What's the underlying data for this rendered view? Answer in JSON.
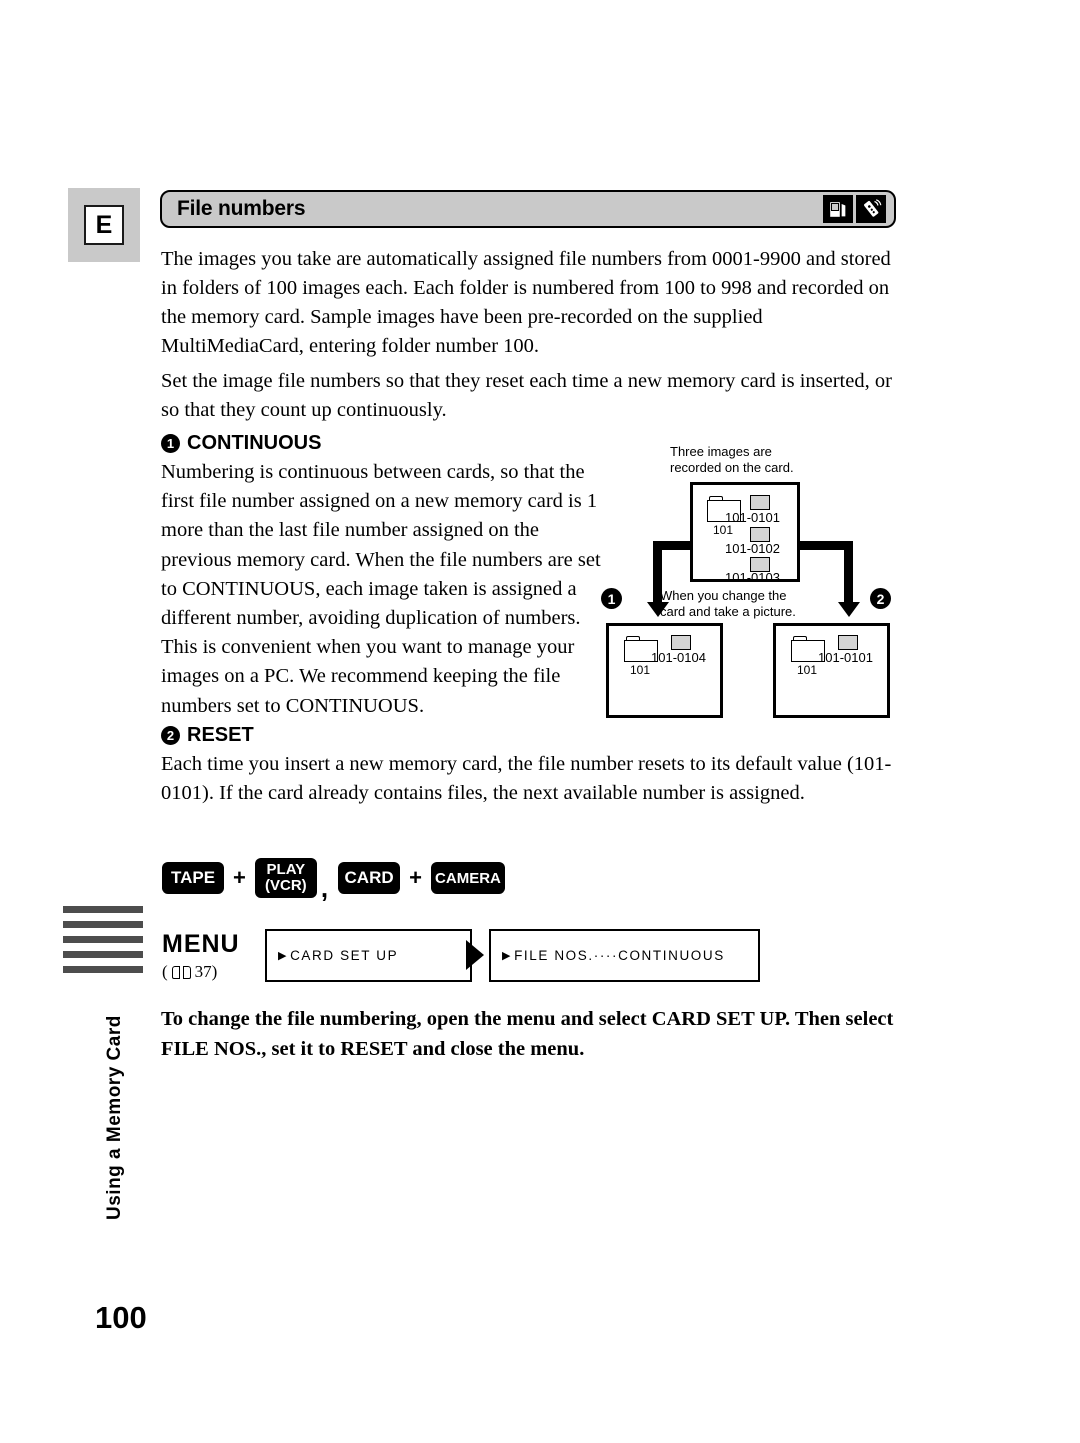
{
  "page": {
    "number": "100",
    "edition_marker": "E",
    "sidebar_vertical_text": "Using a Memory Card"
  },
  "header": {
    "title": "File numbers",
    "icons": [
      "memory-card-icon",
      "remote-control-icon"
    ]
  },
  "intro": {
    "paragraph_1": "The images you take are automatically assigned file numbers from 0001-9900 and stored in folders of 100 images each. Each folder is numbered from 100 to 998 and recorded on the memory card. Sample images have been pre-recorded on the supplied MultiMediaCard, entering folder number 100.",
    "paragraph_2": "Set the image file numbers so that they reset each time a new memory card is inserted, or so that they count up continuously."
  },
  "sections": [
    {
      "number": "1",
      "title": "CONTINUOUS",
      "body": "Numbering is continuous between cards, so that the first file number assigned on a new memory card is 1 more than the last file number assigned on the previous memory card. When the file numbers are set to CONTINUOUS, each image taken is assigned a different number, avoiding duplication of numbers. This is convenient when you want to manage your images on a PC. We recommend keeping the file numbers set to CONTINUOUS."
    },
    {
      "number": "2",
      "title": "RESET",
      "body": "Each time you insert a new memory card, the file number resets to its default value (101-0101). If the card already contains files, the next available number is assigned."
    }
  ],
  "diagram": {
    "caption_top": "Three images are\nrecorded on the card.",
    "caption_middle": "When you change the\ncard and take a picture.",
    "marker_left": "1",
    "marker_right": "2",
    "top_card": {
      "folder": "101",
      "files": [
        "101-0101",
        "101-0102",
        "101-0103"
      ]
    },
    "left_card": {
      "folder": "101",
      "files": [
        "101-0104"
      ]
    },
    "right_card": {
      "folder": "101",
      "files": [
        "101-0101"
      ]
    }
  },
  "buttons": {
    "tape": "TAPE",
    "plus_1": "+",
    "play_line_1": "PLAY",
    "play_line_2": "(VCR)",
    "comma": ",",
    "card": "CARD",
    "plus_2": "+",
    "camera": "CAMERA"
  },
  "menu": {
    "label": "MENU",
    "reference_open": "(",
    "reference_page": "37)",
    "box_1": "CARD SET UP",
    "box_2": "FILE NOS.····CONTINUOUS",
    "caret": "▶"
  },
  "instruction": "To change the file numbering, open the menu and select CARD SET UP. Then select FILE NOS., set it to RESET and close the menu."
}
